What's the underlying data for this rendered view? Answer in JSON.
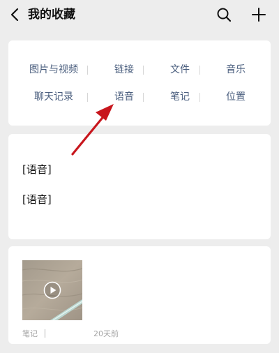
{
  "header": {
    "title": "我的收藏",
    "back_icon": "chevron-left-icon",
    "search_icon": "search-icon",
    "add_icon": "plus-icon"
  },
  "categories": {
    "row1": [
      "图片与视频",
      "链接",
      "文件",
      "音乐"
    ],
    "row2": [
      "聊天记录",
      "语音",
      "笔记",
      "位置"
    ]
  },
  "note_card": {
    "lines": [
      "[语音]",
      "[语音]"
    ]
  },
  "media_card": {
    "thumbnail_icon": "play-icon",
    "type_label": "笔记",
    "time_label": "20天前"
  },
  "annotation": {
    "color": "#c8161d",
    "points_to": "语音"
  },
  "colors": {
    "background": "#ededed",
    "card": "#ffffff",
    "category_text": "#4a5e7e",
    "meta_text": "#a3a3a3"
  }
}
